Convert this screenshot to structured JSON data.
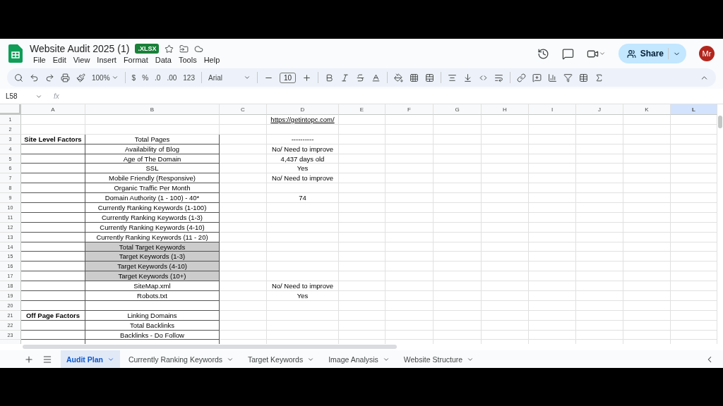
{
  "document": {
    "title": "Website Audit 2025 (1)",
    "badge": ".XLSX"
  },
  "menu": [
    "File",
    "Edit",
    "View",
    "Insert",
    "Format",
    "Data",
    "Tools",
    "Help"
  ],
  "share": {
    "label": "Share"
  },
  "avatar": {
    "initials": "Mr"
  },
  "toolbar": {
    "zoom": "100%",
    "currency": "$",
    "percent": "%",
    "decrease_decimal": ".0",
    "increase_decimal": ".00",
    "number_format": "123",
    "font": "Arial",
    "font_size": "10"
  },
  "formula_bar": {
    "cell_ref": "L58",
    "fx": "fx"
  },
  "columns": [
    {
      "label": "A",
      "selected": false
    },
    {
      "label": "B",
      "selected": false
    },
    {
      "label": "C",
      "selected": false
    },
    {
      "label": "D",
      "selected": false
    },
    {
      "label": "E",
      "selected": false
    },
    {
      "label": "F",
      "selected": false
    },
    {
      "label": "G",
      "selected": false
    },
    {
      "label": "H",
      "selected": false
    },
    {
      "label": "I",
      "selected": false
    },
    {
      "label": "J",
      "selected": false
    },
    {
      "label": "K",
      "selected": false
    },
    {
      "label": "L",
      "selected": true
    }
  ],
  "rows": [
    {
      "number": "1",
      "bordered": false,
      "shaded": false,
      "d": {
        "text": "https://getintopc.com/",
        "kind": "link"
      }
    },
    {
      "number": "2",
      "bordered": false,
      "shaded": false
    },
    {
      "number": "3",
      "bordered": true,
      "shaded": false,
      "a": "Site Level Factors",
      "b": "Total Pages",
      "d": {
        "text": "----------",
        "kind": "text"
      }
    },
    {
      "number": "4",
      "bordered": true,
      "shaded": false,
      "b": "Availability of Blog",
      "d": {
        "text": "No/ Need to improve",
        "kind": "text"
      }
    },
    {
      "number": "5",
      "bordered": true,
      "shaded": false,
      "b": "Age of The Domain",
      "d": {
        "text": "4,437 days old",
        "kind": "text"
      }
    },
    {
      "number": "6",
      "bordered": true,
      "shaded": false,
      "b": "SSL",
      "d": {
        "text": "Yes",
        "kind": "text"
      }
    },
    {
      "number": "7",
      "bordered": true,
      "shaded": false,
      "b": "Mobile Friendly (Responsive)",
      "d": {
        "text": "No/ Need to improve",
        "kind": "text"
      }
    },
    {
      "number": "8",
      "bordered": true,
      "shaded": false,
      "b": "Organic Traffic Per Month"
    },
    {
      "number": "9",
      "bordered": true,
      "shaded": false,
      "b": "Domain Authority (1 - 100) - 40*",
      "d": {
        "text": "74",
        "kind": "text"
      }
    },
    {
      "number": "10",
      "bordered": true,
      "shaded": false,
      "b": "Currently Ranking Keywords (1-100)"
    },
    {
      "number": "11",
      "bordered": true,
      "shaded": false,
      "b": "Currently Ranking Keywords (1-3)"
    },
    {
      "number": "12",
      "bordered": true,
      "shaded": false,
      "b": "Currently Ranking Keywords (4-10)"
    },
    {
      "number": "13",
      "bordered": true,
      "shaded": false,
      "b": "Currently  Ranking Keywords (11 - 20)"
    },
    {
      "number": "14",
      "bordered": true,
      "shaded": true,
      "b": "Total Target Keywords"
    },
    {
      "number": "15",
      "bordered": true,
      "shaded": true,
      "b": "Target Keywords (1-3)"
    },
    {
      "number": "16",
      "bordered": true,
      "shaded": true,
      "b": "Target Keywords (4-10)"
    },
    {
      "number": "17",
      "bordered": true,
      "shaded": true,
      "b": "Target Keywords (10+)"
    },
    {
      "number": "18",
      "bordered": true,
      "shaded": false,
      "b": "SiteMap.xml",
      "d": {
        "text": "No/ Need to improve",
        "kind": "text"
      }
    },
    {
      "number": "19",
      "bordered": true,
      "shaded": false,
      "b": "Robots.txt",
      "d": {
        "text": "Yes",
        "kind": "text"
      }
    },
    {
      "number": "20",
      "bordered": true,
      "shaded": false
    },
    {
      "number": "21",
      "bordered": true,
      "shaded": false,
      "a": "Off Page Factors",
      "b": "Linking Domains"
    },
    {
      "number": "22",
      "bordered": true,
      "shaded": false,
      "b": "Total Backlinks"
    },
    {
      "number": "23",
      "bordered": true,
      "shaded": false,
      "b": "Backlinks - Do Follow"
    }
  ],
  "sheets": [
    {
      "label": "Audit Plan",
      "selected": true
    },
    {
      "label": "Currently Ranking Keywords",
      "selected": false
    },
    {
      "label": "Target Keywords",
      "selected": false
    },
    {
      "label": "Image Analysis",
      "selected": false
    },
    {
      "label": "Website Structure",
      "selected": false
    }
  ]
}
